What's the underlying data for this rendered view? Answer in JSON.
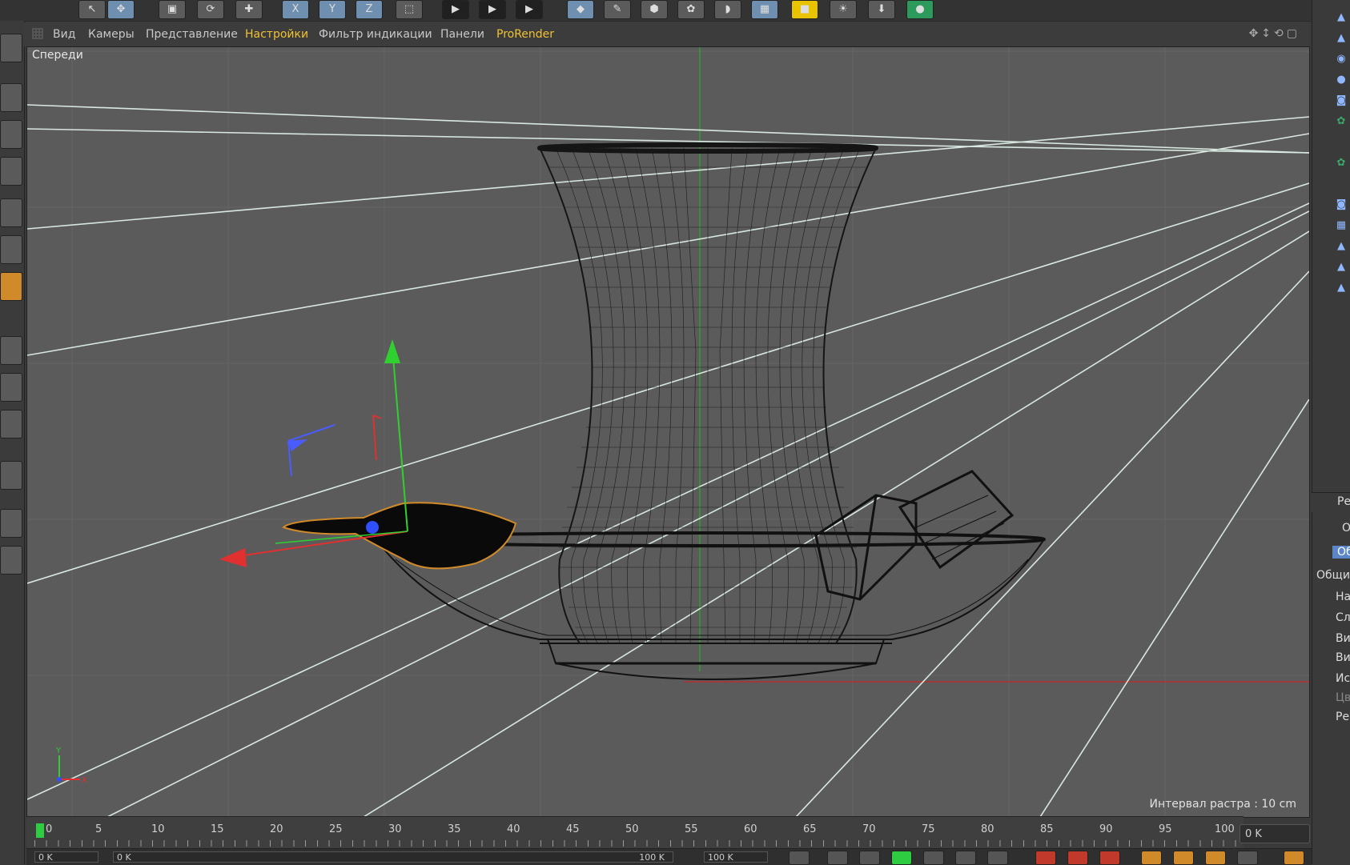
{
  "menubar": {
    "items": [
      "Вид",
      "Камеры",
      "Представление",
      "Настройки",
      "Фильтр индикации",
      "Панели",
      "ProRender"
    ],
    "active_item": "Настройки"
  },
  "viewport": {
    "label": "Спереди",
    "grid_info": "Интервал растра : 10 cm",
    "axis_x_label": "X",
    "axis_y_label": "Y"
  },
  "timeline": {
    "ticks": [
      "0",
      "5",
      "10",
      "15",
      "20",
      "25",
      "30",
      "35",
      "40",
      "45",
      "50",
      "55",
      "60",
      "65",
      "70",
      "75",
      "80",
      "85",
      "90",
      "95",
      "100"
    ],
    "current_frame_field": "0 K"
  },
  "bottom_bar": {
    "start_field": "0 K",
    "range_field": "0 K",
    "range_end_field": "100 K",
    "end_field": "100 K"
  },
  "attributes_panel": {
    "header": "Ре",
    "object_label": "О",
    "tab": "Об",
    "section": "Общи",
    "rows": [
      "На",
      "Сл",
      "Ви",
      "Ви",
      "Ис",
      "Цв",
      "Ре"
    ]
  },
  "icons": {
    "top_toolbar": [
      "select-icon",
      "move-icon",
      "scale-icon",
      "rotate-icon",
      "add-icon",
      "x-axis-icon",
      "y-axis-icon",
      "z-axis-icon",
      "coordinate-icon",
      "render-view-icon",
      "render-picture-icon",
      "render-settings-icon",
      "cube-icon",
      "pen-icon",
      "subdivision-icon",
      "cloner-icon",
      "deformer-icon",
      "floor-icon",
      "camera-icon",
      "light-icon",
      "tag-icon"
    ],
    "colors": {
      "accent": "#f1c232",
      "selection": "#d08a2a",
      "x_axis": "#e03030",
      "y_axis": "#30d030",
      "z_axis": "#3050ff"
    }
  }
}
